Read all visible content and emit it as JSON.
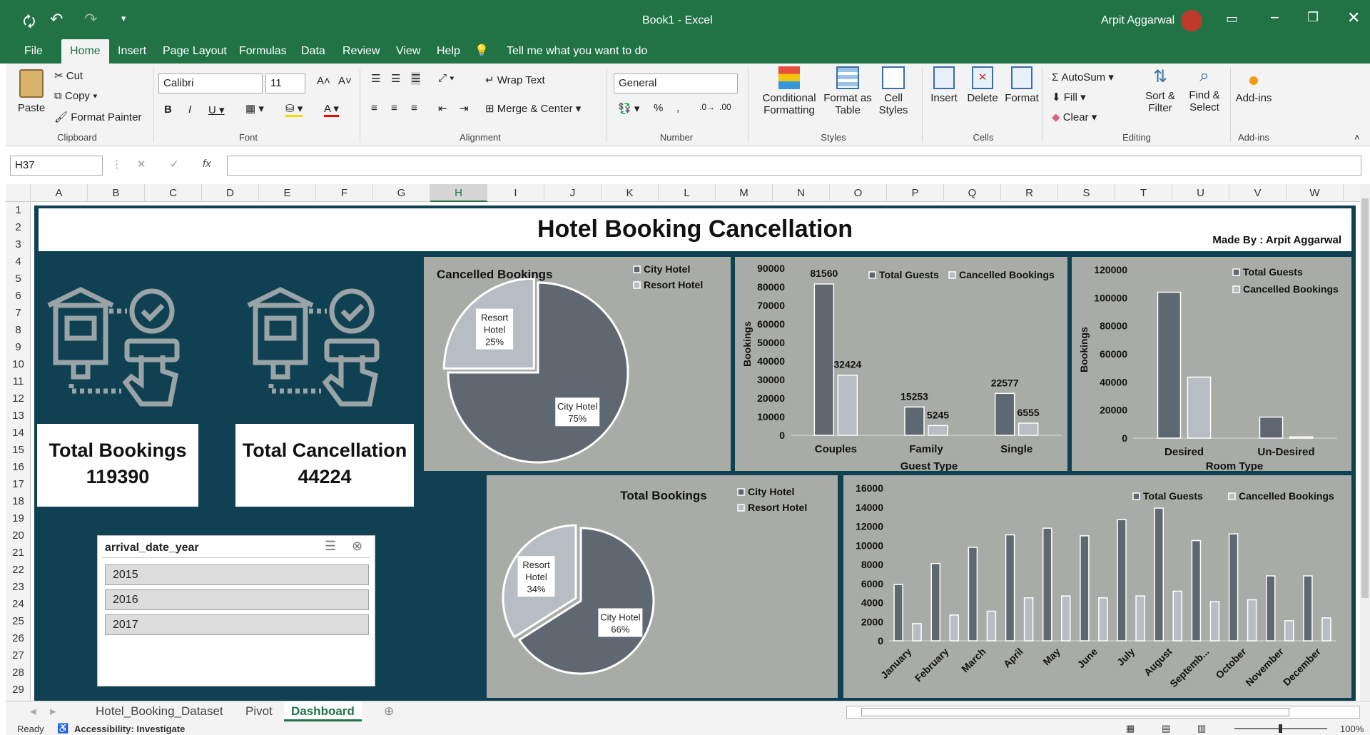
{
  "window": {
    "title": "Book1  -  Excel",
    "user": "Arpit Aggarwal"
  },
  "tabs": [
    "File",
    "Home",
    "Insert",
    "Page Layout",
    "Formulas",
    "Data",
    "Review",
    "View",
    "Help"
  ],
  "tell_me": "Tell me what you want to do",
  "ribbon": {
    "clipboard": {
      "paste": "Paste",
      "cut": "Cut",
      "copy": "Copy",
      "format_painter": "Format Painter",
      "label": "Clipboard"
    },
    "font": {
      "name": "Calibri",
      "size": "11",
      "label": "Font"
    },
    "alignment": {
      "wrap": "Wrap Text",
      "merge": "Merge & Center",
      "label": "Alignment"
    },
    "number": {
      "format": "General",
      "label": "Number"
    },
    "styles": {
      "cond1": "Conditional",
      "cond2": "Formatting",
      "fmt1": "Format as",
      "fmt2": "Table",
      "cell1": "Cell",
      "cell2": "Styles",
      "label": "Styles"
    },
    "cells": {
      "insert": "Insert",
      "delete": "Delete",
      "format": "Format",
      "label": "Cells"
    },
    "editing": {
      "autosum": "AutoSum",
      "fill": "Fill",
      "clear": "Clear",
      "sort1": "Sort &",
      "sort2": "Filter",
      "find1": "Find &",
      "find2": "Select",
      "label": "Editing"
    },
    "addins": {
      "btn": "Add-ins",
      "label": "Add-ins"
    }
  },
  "formula_bar": {
    "name_box": "H37",
    "formula": ""
  },
  "columns": [
    "A",
    "B",
    "C",
    "D",
    "E",
    "F",
    "G",
    "H",
    "I",
    "J",
    "K",
    "L",
    "M",
    "N",
    "O",
    "P",
    "Q",
    "R",
    "S",
    "T",
    "U",
    "V",
    "W"
  ],
  "rows": [
    "1",
    "2",
    "3",
    "4",
    "5",
    "6",
    "7",
    "8",
    "9",
    "10",
    "11",
    "12",
    "13",
    "14",
    "15",
    "16",
    "17",
    "18",
    "19",
    "20",
    "21",
    "22",
    "23",
    "24",
    "25",
    "26",
    "27",
    "28",
    "29"
  ],
  "dashboard": {
    "title": "Hotel Booking Cancellation",
    "made_by": "Made By : Arpit Aggarwal",
    "total_bookings_label": "Total Bookings",
    "total_bookings_value": "119390",
    "total_cancellation_label": "Total Cancellation",
    "total_cancellation_value": "44224",
    "slicer": {
      "title": "arrival_date_year",
      "items": [
        "2015",
        "2016",
        "2017"
      ]
    }
  },
  "sheet_tabs": [
    "Hotel_Booking_Dataset",
    "Pivot",
    "Dashboard"
  ],
  "status": {
    "ready": "Ready",
    "accessibility": "Accessibility: Investigate",
    "zoom": "100%"
  },
  "colors": {
    "excel_green": "#217346",
    "dash_bg": "#104152",
    "panel": "#a9aca6",
    "dark_series": "#5f6770",
    "light_series": "#b8bdc3"
  },
  "chart_data": [
    {
      "type": "pie",
      "title": "Cancelled Bookings",
      "categories": [
        "City Hotel",
        "Resort Hotel"
      ],
      "values": [
        75,
        25
      ],
      "labels": [
        "City Hotel 75%",
        "Resort Hotel 25%"
      ],
      "legend": "top-right"
    },
    {
      "type": "bar",
      "title": "",
      "categories": [
        "Couples",
        "Family",
        "Single"
      ],
      "series": [
        {
          "name": "Total Guests",
          "values": [
            81560,
            15253,
            22577
          ]
        },
        {
          "name": "Cancelled Bookings",
          "values": [
            32424,
            5245,
            6555
          ]
        }
      ],
      "xlabel": "Guest Type",
      "ylabel": "Bookings",
      "yticks": [
        "90000",
        "80000",
        "70000",
        "60000",
        "50000",
        "40000",
        "30000",
        "20000",
        "10000",
        "0"
      ],
      "ylim": [
        0,
        90000
      ]
    },
    {
      "type": "bar",
      "title": "",
      "categories": [
        "Desired",
        "Un-Desired"
      ],
      "series": [
        {
          "name": "Total Guests",
          "values": [
            104000,
            15000
          ]
        },
        {
          "name": "Cancelled Bookings",
          "values": [
            43500,
            900
          ]
        }
      ],
      "xlabel": "Room Type",
      "ylabel": "Bookings",
      "yticks": [
        "120000",
        "100000",
        "80000",
        "60000",
        "40000",
        "20000",
        "0"
      ],
      "ylim": [
        0,
        120000
      ]
    },
    {
      "type": "pie",
      "title": "Total Bookings",
      "categories": [
        "City Hotel",
        "Resort Hotel"
      ],
      "values": [
        66,
        34
      ],
      "labels": [
        "City Hotel 66%",
        "Resort Hotel 34%"
      ],
      "legend": "top-right"
    },
    {
      "type": "bar",
      "title": "",
      "categories": [
        "January",
        "February",
        "March",
        "April",
        "May",
        "June",
        "July",
        "August",
        "Septemb...",
        "October",
        "November",
        "December"
      ],
      "series": [
        {
          "name": "Total Guests",
          "values": [
            5900,
            8100,
            9800,
            11100,
            11800,
            11000,
            12700,
            13900,
            10500,
            11200,
            6800,
            6800
          ]
        },
        {
          "name": "Cancelled Bookings",
          "values": [
            1800,
            2700,
            3100,
            4500,
            4700,
            4500,
            4700,
            5200,
            4100,
            4300,
            2100,
            2400
          ]
        }
      ],
      "yticks": [
        "16000",
        "14000",
        "12000",
        "10000",
        "8000",
        "6000",
        "4000",
        "2000",
        "0"
      ],
      "ylim": [
        0,
        16000
      ]
    }
  ]
}
